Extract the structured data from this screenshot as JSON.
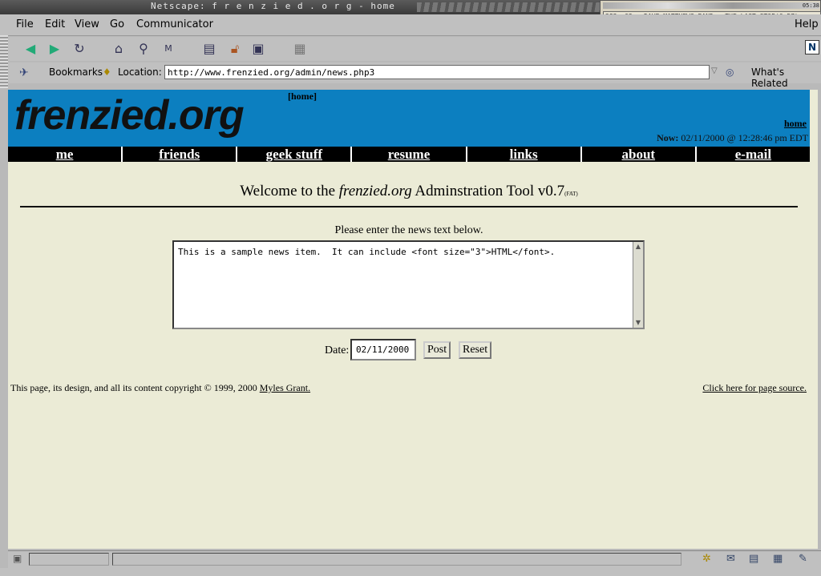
{
  "window": {
    "title": "Netscape: f r e n z i e d . o r g - home"
  },
  "player": {
    "time": "05:38",
    "track": "283. 03 - DAVE MATTHEWS BAND - THE LAST STOP(6:57)"
  },
  "menu": {
    "file": "File",
    "edit": "Edit",
    "view": "View",
    "go": "Go",
    "communicator": "Communicator",
    "help": "Help"
  },
  "toolbar": {
    "icons": [
      "back-icon",
      "forward-icon",
      "reload-icon",
      "home-icon",
      "search-icon",
      "my-netscape-icon",
      "print-icon",
      "security-icon",
      "shop-icon",
      "stop-icon"
    ]
  },
  "location": {
    "bookmarks": "Bookmarks",
    "location_label": "Location:",
    "url": "http://www.frenzied.org/admin/news.php3",
    "whats_related": "What's Related"
  },
  "site": {
    "logo": "frenzied.org",
    "home_bracket": "[home]",
    "home_link": "home",
    "now_label": "Now:",
    "now_value": "02/11/2000 @ 12:28:46 pm EDT",
    "nav": [
      "me",
      "friends",
      "geek stuff",
      "resume",
      "links",
      "about",
      "e-mail"
    ]
  },
  "admin": {
    "welcome_pre": "Welcome to the",
    "welcome_site": "frenzied.org",
    "welcome_post": "Adminstration Tool v0.7",
    "welcome_tag": "(FAT)",
    "prompt": "Please enter the news text below.",
    "news_text": "This is a sample news item.  It can include <font size=\"3\">HTML</font>.",
    "date_label": "Date:",
    "date_value": "02/11/2000",
    "post": "Post",
    "reset": "Reset"
  },
  "footer": {
    "copyright": "This page, its design, and all its content copyright © 1999, 2000",
    "author": "Myles Grant.",
    "source_link": "Click here for page source."
  },
  "colors": {
    "banner": "#0c7fc0",
    "page_bg": "#ebebd6",
    "navbar": "#000000"
  }
}
